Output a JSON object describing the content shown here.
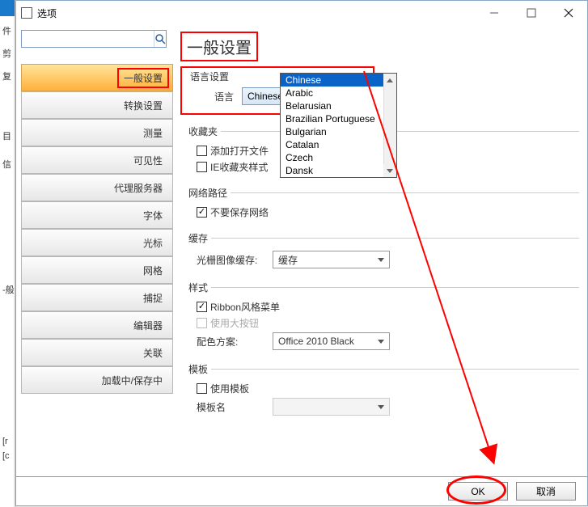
{
  "window": {
    "title": "选项"
  },
  "search": {
    "placeholder": ""
  },
  "sidebar": {
    "items": [
      {
        "label": "一般设置",
        "active": true
      },
      {
        "label": "转换设置"
      },
      {
        "label": "测量"
      },
      {
        "label": "可见性"
      },
      {
        "label": "代理服务器"
      },
      {
        "label": "字体"
      },
      {
        "label": "光标"
      },
      {
        "label": "网格"
      },
      {
        "label": "捕捉"
      },
      {
        "label": "编辑器"
      },
      {
        "label": "关联"
      },
      {
        "label": "加载中/保存中"
      }
    ]
  },
  "main": {
    "heading": "一般设置",
    "lang_group": {
      "legend": "语言设置",
      "label": "语言",
      "value": "Chinese",
      "options": [
        "Chinese",
        "Arabic",
        "Belarusian",
        "Brazilian Portuguese",
        "Bulgarian",
        "Catalan",
        "Czech",
        "Dansk"
      ]
    },
    "fav": {
      "legend": "收藏夹",
      "chk1": "添加打开文件",
      "chk2": "IE收藏夹样式"
    },
    "net": {
      "legend": "网络路径",
      "chk": "不要保存网络"
    },
    "cache": {
      "legend": "缓存",
      "label": "光栅图像缓存:",
      "value": "缓存"
    },
    "style": {
      "legend": "样式",
      "chk_ribbon": "Ribbon风格菜单",
      "chk_big": "使用大按钮",
      "color_label": "配色方案:",
      "color_value": "Office 2010 Black"
    },
    "template": {
      "legend": "模板",
      "chk": "使用模板",
      "name_label": "模板名",
      "name_value": ""
    }
  },
  "buttons": {
    "ok": "OK",
    "cancel": "取消"
  },
  "leftstrip": [
    "件",
    "剪",
    "复",
    "目",
    "信",
    "-般",
    "[r",
    "[c"
  ]
}
